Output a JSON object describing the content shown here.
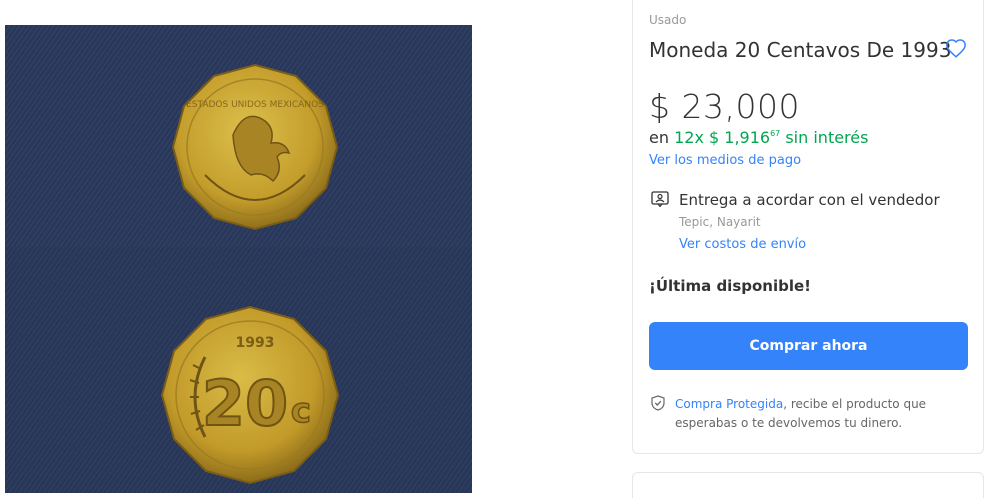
{
  "product": {
    "condition": "Usado",
    "title": "Moneda 20 Centavos De 1993",
    "price": "$ 23,000",
    "installments": {
      "prefix": "en",
      "count_amount": "12x $ 1,916",
      "cents": "67",
      "suffix": "sin interés"
    },
    "payment_methods_link": "Ver los medios de pago"
  },
  "shipping": {
    "title": "Entrega a acordar con el vendedor",
    "location": "Tepic, Nayarit",
    "costs_link": "Ver costos de envío"
  },
  "stock": "¡Última disponible!",
  "buy_button": "Comprar ahora",
  "protection": {
    "link": "Compra Protegida",
    "text": ", recibe el producto que esperabas o te devolvemos tu dinero."
  },
  "coin_back": {
    "value": "20",
    "currency_sign": "c",
    "year": "1993"
  },
  "colors": {
    "accent": "#3483fa",
    "green": "#00a650",
    "denim": "#2f3f63",
    "coin": "#c9a431"
  },
  "icons": [
    "heart-icon",
    "person-pin-icon",
    "shield-check-icon"
  ]
}
